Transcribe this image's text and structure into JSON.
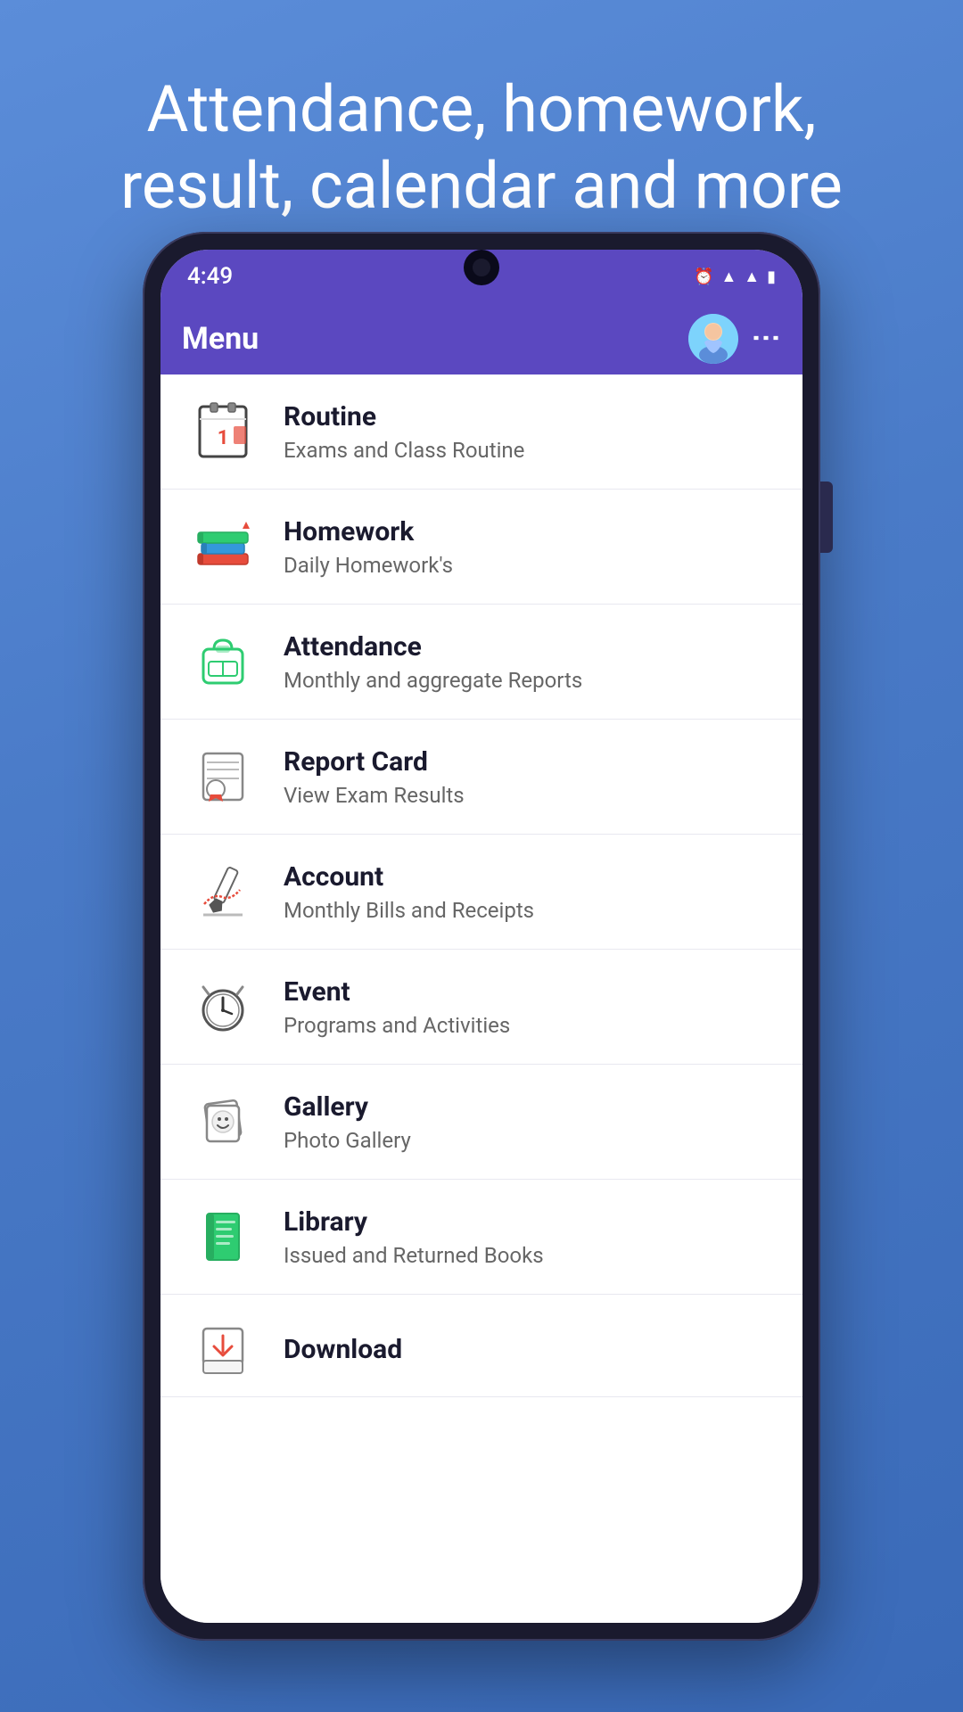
{
  "hero": {
    "text": "Attendance, homework, result, calendar and more"
  },
  "status_bar": {
    "time": "4:49",
    "icons": [
      "🔔",
      "↻",
      "↻",
      "↻",
      "✦",
      "⏰",
      "▲",
      "✕",
      "▲",
      "▌"
    ]
  },
  "app_bar": {
    "title": "Menu",
    "more_icon": "⋮"
  },
  "menu_items": [
    {
      "id": "routine",
      "title": "Routine",
      "subtitle": "Exams and Class Routine"
    },
    {
      "id": "homework",
      "title": "Homework",
      "subtitle": "Daily Homework's"
    },
    {
      "id": "attendance",
      "title": "Attendance",
      "subtitle": "Monthly and aggregate Reports"
    },
    {
      "id": "report-card",
      "title": "Report Card",
      "subtitle": "View Exam Results"
    },
    {
      "id": "account",
      "title": "Account",
      "subtitle": "Monthly Bills and Receipts"
    },
    {
      "id": "event",
      "title": "Event",
      "subtitle": "Programs and Activities"
    },
    {
      "id": "gallery",
      "title": "Gallery",
      "subtitle": "Photo Gallery"
    },
    {
      "id": "library",
      "title": "Library",
      "subtitle": "Issued and Returned Books"
    },
    {
      "id": "download",
      "title": "Download",
      "subtitle": ""
    }
  ]
}
